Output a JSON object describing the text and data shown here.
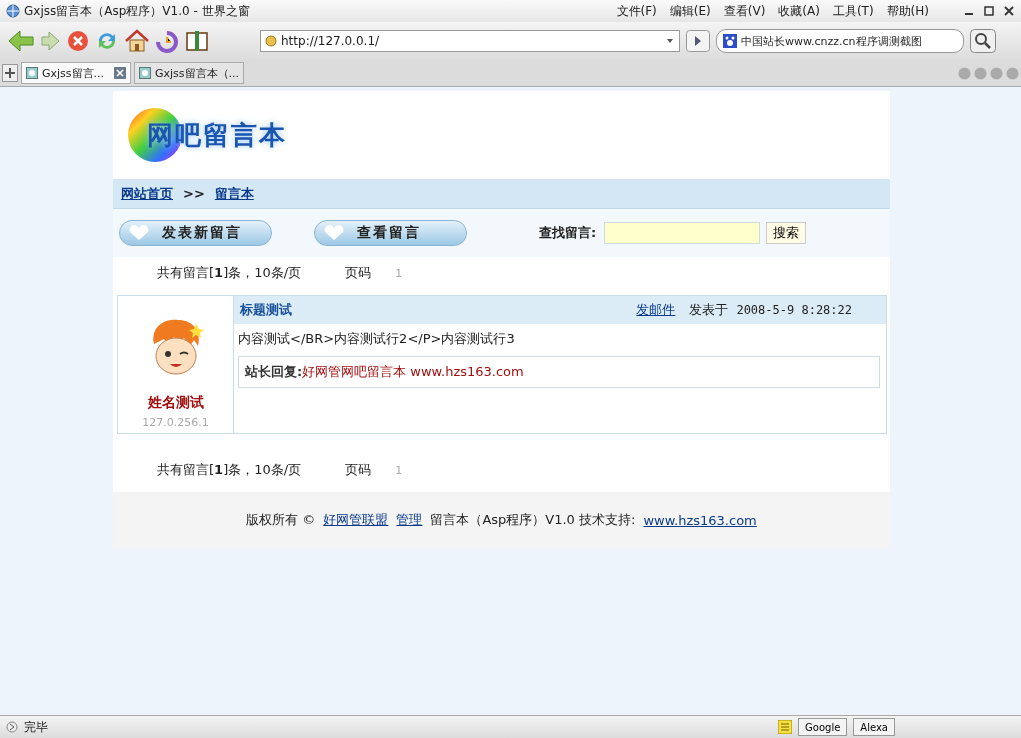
{
  "window": {
    "title": "Gxjss留言本（Asp程序）V1.0 - 世界之窗"
  },
  "menu": [
    "文件(F)",
    "编辑(E)",
    "查看(V)",
    "收藏(A)",
    "工具(T)",
    "帮助(H)"
  ],
  "address": {
    "url": "http://127.0.0.1/"
  },
  "search_field": {
    "value": "中国站长www.cnzz.cn程序调测截图"
  },
  "tabs": [
    {
      "label": "Gxjss留言...",
      "selected": true
    },
    {
      "label": "Gxjss留言本（...",
      "selected": false
    }
  ],
  "page": {
    "logo_text": "网吧留言本",
    "breadcrumb": [
      {
        "kind": "link",
        "text": "网站首页"
      },
      {
        "kind": "sep",
        "text": ">>"
      },
      {
        "kind": "link",
        "text": "留言本"
      }
    ],
    "buttons": [
      "发表新留言",
      "查看留言"
    ],
    "find": {
      "label": "查找留言:",
      "button": "搜索"
    },
    "pager_top": {
      "summary": "共有留言[**1**]条，10条/页",
      "page_label": "页码",
      "page": "1"
    },
    "messages": [
      {
        "author": "姓名测试",
        "ip": "127.0.256.1",
        "title": "标题测试",
        "email_link": "发邮件",
        "posted_label": "发表于",
        "date": "2008-5-9 8:28:22",
        "content": "内容测试</BR>内容测试行2</P>内容测试行3",
        "reply_label": "站长回复:",
        "reply": "好网管网吧留言本 www.hzs163.com"
      }
    ],
    "pager_bottom": {
      "summary": "共有留言[**1**]条，10条/页",
      "page_label": "页码",
      "page": "1"
    },
    "footer": [
      {
        "kind": "text",
        "text": "版权所有 ©"
      },
      {
        "kind": "link",
        "text": "好网管联盟"
      },
      {
        "kind": "link",
        "text": "管理"
      },
      {
        "kind": "text",
        "text": "留言本（Asp程序）V1.0  技术支持:"
      },
      {
        "kind": "link",
        "text": "www.hzs163.com"
      }
    ]
  },
  "status_bar": {
    "text": "完毕",
    "toolbar_buttons": [
      "Google",
      "Alexa"
    ]
  }
}
